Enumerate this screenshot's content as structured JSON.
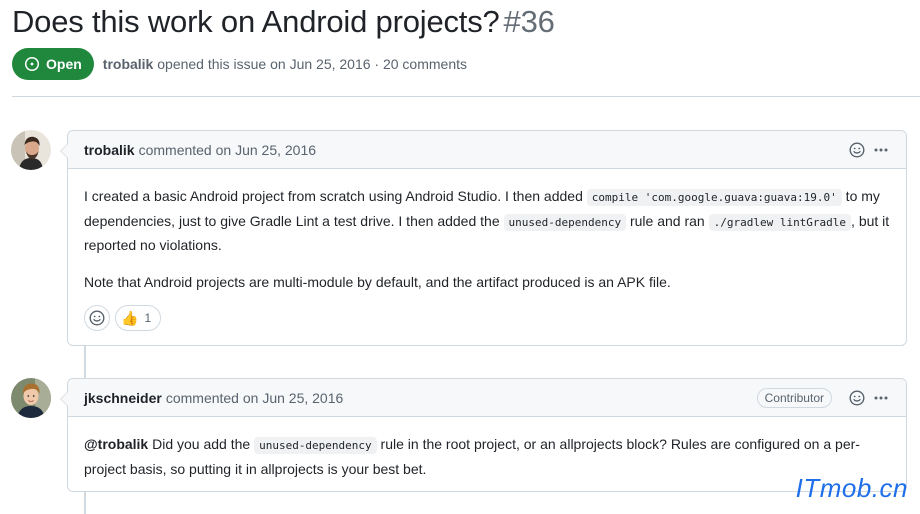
{
  "issue": {
    "title": "Does this work on Android projects?",
    "number": "#36",
    "status": "Open",
    "status_color": "#1f883d",
    "opened_by": "trobalik",
    "opened_text": "opened this issue on Jun 25, 2016 · 20 comments"
  },
  "comments": [
    {
      "author": "trobalik",
      "time_text": "commented on Jun 25, 2016",
      "avatar_icon": "user-avatar",
      "body": {
        "p1_part1": "I created a basic Android project from scratch using Android Studio. I then added ",
        "p1_code1": "compile 'com.google.guava:guava:19.0'",
        "p1_part2": " to my dependencies, just to give Gradle Lint a test drive. I then added the ",
        "p1_code2": "unused-dependency",
        "p1_part3": " rule and ran ",
        "p1_code3": "./gradlew lintGradle",
        "p1_part4": ", but it reported no violations.",
        "p2": "Note that Android projects are multi-module by default, and the artifact produced is an APK file."
      },
      "reactions": [
        {
          "emoji": "👍",
          "count": "1"
        }
      ]
    },
    {
      "author": "jkschneider",
      "time_text": "commented on Jun 25, 2016",
      "role": "Contributor",
      "avatar_icon": "user-avatar",
      "body": {
        "mention": "@trobalik",
        "part1": " Did you add the ",
        "code1": "unused-dependency",
        "part2": " rule in the root project, or an allprojects block? Rules are configured on a per-project basis, so putting it in allprojects is your best bet."
      }
    }
  ],
  "watermark": "ITmob.cn"
}
